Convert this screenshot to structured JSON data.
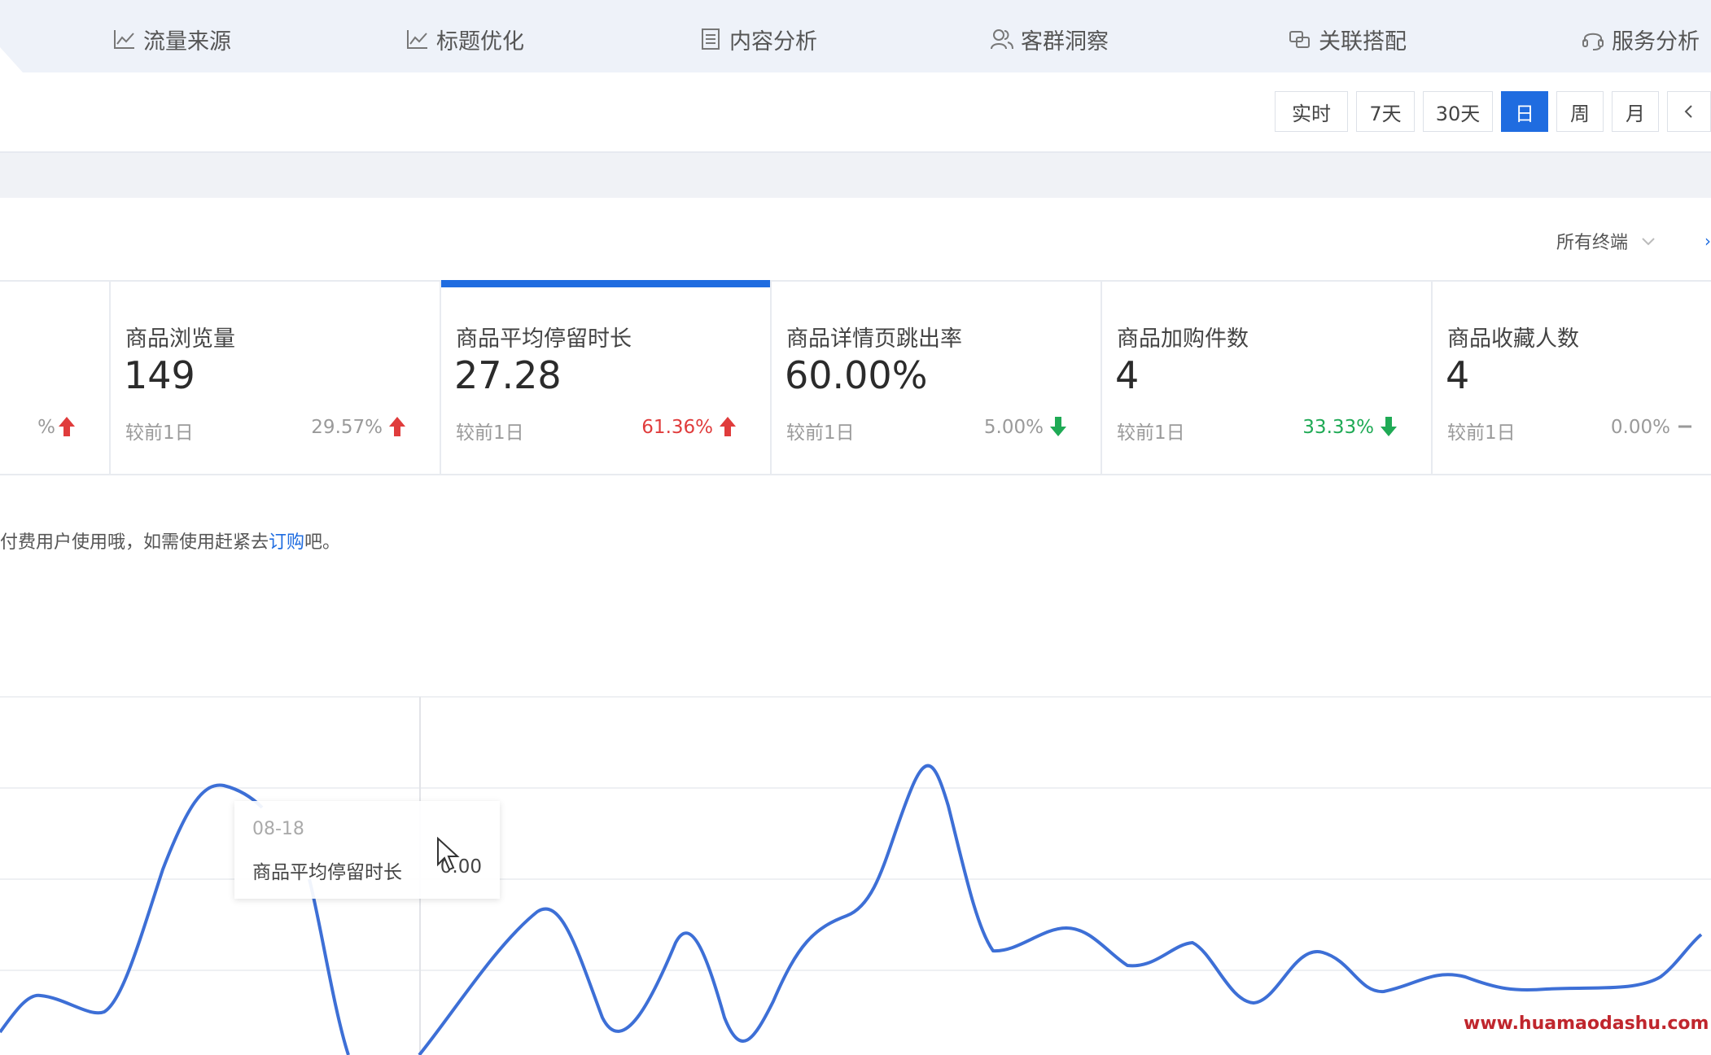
{
  "nav": {
    "items": [
      {
        "label": "流量来源",
        "icon": "line-chart-icon"
      },
      {
        "label": "标题优化",
        "icon": "line-chart-icon"
      },
      {
        "label": "内容分析",
        "icon": "document-icon"
      },
      {
        "label": "客群洞察",
        "icon": "users-icon"
      },
      {
        "label": "关联搭配",
        "icon": "link-icon"
      },
      {
        "label": "服务分析",
        "icon": "headset-icon"
      }
    ]
  },
  "toolbar": {
    "buttons": [
      "实时",
      "7天",
      "30天",
      "日",
      "周",
      "月"
    ],
    "active": "日",
    "prev_icon": "chevron-left-icon"
  },
  "filter": {
    "terminal_label": "所有终端"
  },
  "cards": [
    {
      "partial_change": "%"
    },
    {
      "title": "商品浏览量",
      "value": "149",
      "compare": "较前1日",
      "change": "29.57%",
      "trend": "up"
    },
    {
      "title": "商品平均停留时长",
      "value": "27.28",
      "compare": "较前1日",
      "change": "61.36%",
      "trend": "up",
      "active": true
    },
    {
      "title": "商品详情页跳出率",
      "value": "60.00%",
      "compare": "较前1日",
      "change": "5.00%",
      "trend": "down"
    },
    {
      "title": "商品加购件数",
      "value": "4",
      "compare": "较前1日",
      "change": "33.33%",
      "trend": "down"
    },
    {
      "title": "商品收藏人数",
      "value": "4",
      "compare": "较前1日",
      "change": "0.00%",
      "trend": "flat"
    }
  ],
  "notice": {
    "prefix": "付费用户使用哦，如需使用赶紧去",
    "link": "订购",
    "suffix": "吧。"
  },
  "tooltip": {
    "date": "08-18",
    "label": "商品平均停留时长",
    "value": "0.00"
  },
  "watermark": "www.huamaodashu.com",
  "colors": {
    "accent": "#1f6ce0",
    "up": "#e03c3c",
    "down": "#1faa55",
    "line": "#3d6fd6"
  }
}
